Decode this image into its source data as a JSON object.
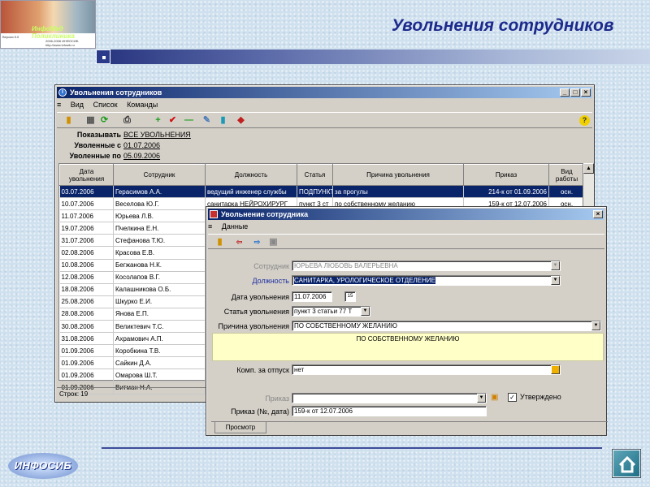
{
  "slide": {
    "title": "Увольнения сотрудников"
  },
  "logo": {
    "brand": "ИнфоМед Поликлиника",
    "fine": [
      "Версия 5.0",
      "2006-2006 ИНФОСИБ",
      "http://www.infosib.ru"
    ]
  },
  "main_window": {
    "title": "Увольнения сотрудников",
    "menu": [
      "Вид",
      "Список",
      "Команды"
    ],
    "filters": {
      "show_label": "Показывать",
      "show_value": "ВСЕ УВОЛЬНЕНИЯ",
      "from_label": "Уволенные с",
      "from_value": "01.07.2006",
      "to_label": "Уволенные по",
      "to_value": "05.09.2006"
    },
    "columns": [
      "Дата увольнения",
      "Сотрудник",
      "Должность",
      "Статья",
      "Причина увольнения",
      "Приказ",
      "Вид работы"
    ],
    "rows": [
      {
        "date": "03.07.2006",
        "employee": "Герасимов А.А.",
        "position": "ведущий инженер службы",
        "article": "ПОДПУНКТ",
        "reason": "за прогулы",
        "order": "214-к от 01.09.2006",
        "work": "осн."
      },
      {
        "date": "10.07.2006",
        "employee": "Веселова Ю.Г.",
        "position": "санитарка НЕЙРОХИРУРГ",
        "article": "пункт 3 ст",
        "reason": "по собственному желанию",
        "order": "159-к от 12.07.2006",
        "work": "осн."
      },
      {
        "date": "11.07.2006",
        "employee": "Юрьева Л.В.",
        "position": "",
        "article": "",
        "reason": "",
        "order": "",
        "work": ""
      },
      {
        "date": "19.07.2006",
        "employee": "Пчелкина Е.Н.",
        "position": "",
        "article": "",
        "reason": "",
        "order": "",
        "work": ""
      },
      {
        "date": "31.07.2006",
        "employee": "Стефанова Т.Ю.",
        "position": "",
        "article": "",
        "reason": "",
        "order": "",
        "work": ""
      },
      {
        "date": "02.08.2006",
        "employee": "Красова Е.В.",
        "position": "",
        "article": "",
        "reason": "",
        "order": "",
        "work": ""
      },
      {
        "date": "10.08.2006",
        "employee": "Бегжанова Н.К.",
        "position": "",
        "article": "",
        "reason": "",
        "order": "",
        "work": ""
      },
      {
        "date": "12.08.2006",
        "employee": "Косолапов В.Г.",
        "position": "",
        "article": "",
        "reason": "",
        "order": "",
        "work": ""
      },
      {
        "date": "18.08.2006",
        "employee": "Калашникова О.Б.",
        "position": "",
        "article": "",
        "reason": "",
        "order": "",
        "work": ""
      },
      {
        "date": "25.08.2006",
        "employee": "Шкурко Е.И.",
        "position": "",
        "article": "",
        "reason": "",
        "order": "",
        "work": ""
      },
      {
        "date": "28.08.2006",
        "employee": "Янова Е.П.",
        "position": "",
        "article": "",
        "reason": "",
        "order": "",
        "work": ""
      },
      {
        "date": "30.08.2006",
        "employee": "Великтевич Т.С.",
        "position": "",
        "article": "",
        "reason": "",
        "order": "",
        "work": ""
      },
      {
        "date": "31.08.2006",
        "employee": "Ахрамович А.П.",
        "position": "",
        "article": "",
        "reason": "",
        "order": "",
        "work": ""
      },
      {
        "date": "01.09.2006",
        "employee": "Коробкина Т.В.",
        "position": "",
        "article": "",
        "reason": "",
        "order": "",
        "work": ""
      },
      {
        "date": "01.09.2006",
        "employee": "Сайкин Д.А.",
        "position": "",
        "article": "",
        "reason": "",
        "order": "",
        "work": ""
      },
      {
        "date": "01.09.2006",
        "employee": "Омарова Ш.Т.",
        "position": "",
        "article": "",
        "reason": "",
        "order": "",
        "work": ""
      },
      {
        "date": "01.09.2006",
        "employee": "Витман Н.А.",
        "position": "",
        "article": "",
        "reason": "",
        "order": "",
        "work": ""
      }
    ],
    "status": "Строк: 19"
  },
  "dialog": {
    "title": "Увольнение сотрудника",
    "menu": [
      "Данные"
    ],
    "employee_label": "Сотрудник",
    "employee_value": "ЮРЬЕВА ЛЮБОВЬ ВАЛЕРЬЕВНА",
    "position_label": "Должность",
    "position_value": "САНИТАРКА, УРОЛОГИЧЕСКОЕ ОТДЕЛЕНИЕ",
    "date_label": "Дата увольнения",
    "date_value": "11.07.2006",
    "calendar_label": "15",
    "article_label": "Статья увольнения",
    "article_value": "пункт 3 статьи 77 Т",
    "reason_label": "Причина увольнения",
    "reason_value": "ПО СОБСТВЕННОМУ ЖЕЛАНИЮ",
    "reason_text": "ПО СОБСТВЕННОМУ ЖЕЛАНИЮ",
    "comp_label": "Комп. за отпуск",
    "comp_value": "нет",
    "order_label": "Приказ",
    "order_value": "",
    "approved_label": "Утверждено",
    "approved": true,
    "order_num_label": "Приказ (№, дата)",
    "order_num_value": "159-к от 12.07.2006",
    "tab": "Просмотр"
  },
  "footer": {
    "logo": "ИНФОСИБ"
  }
}
